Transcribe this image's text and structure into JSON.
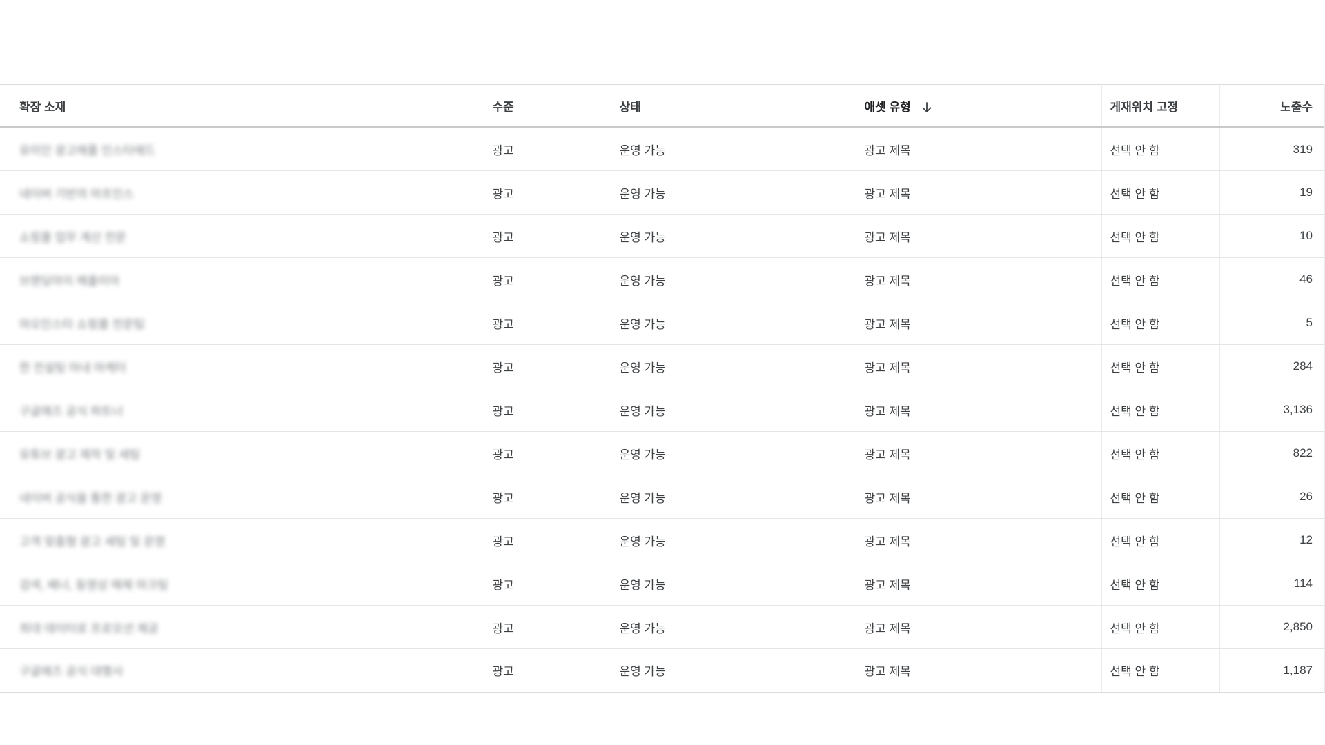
{
  "table": {
    "headers": {
      "asset": "확장 소재",
      "level": "수준",
      "status": "상태",
      "asset_type": "애셋 유형",
      "pinned": "게재위치 고정",
      "impressions": "노출수"
    },
    "sort": {
      "column": "asset_type",
      "direction": "descending",
      "icon": "arrow-down-icon"
    },
    "rows": [
      {
        "asset": "유미인 광고애플 인스타에드",
        "level": "광고",
        "status": "운영 가능",
        "asset_type": "광고 제목",
        "pinned": "선택 안 함",
        "impressions": "319"
      },
      {
        "asset": "네이버 기반의 마프인스",
        "level": "광고",
        "status": "운영 가능",
        "asset_type": "광고 제목",
        "pinned": "선택 안 함",
        "impressions": "19"
      },
      {
        "asset": "쇼핑몰 업무 계산 전문",
        "level": "광고",
        "status": "운영 가능",
        "asset_type": "광고 제목",
        "pinned": "선택 안 함",
        "impressions": "10"
      },
      {
        "asset": "브랜딩마이 매출미아",
        "level": "광고",
        "status": "운영 가능",
        "asset_type": "광고 제목",
        "pinned": "선택 안 함",
        "impressions": "46"
      },
      {
        "asset": "마오인스타 쇼핑몰 전문팀",
        "level": "광고",
        "status": "운영 가능",
        "asset_type": "광고 제목",
        "pinned": "선택 안 함",
        "impressions": "5"
      },
      {
        "asset": "한 컨설팅 마내 마케터",
        "level": "광고",
        "status": "운영 가능",
        "asset_type": "광고 제목",
        "pinned": "선택 안 함",
        "impressions": "284"
      },
      {
        "asset": "구글애즈 공식 파트너",
        "level": "광고",
        "status": "운영 가능",
        "asset_type": "광고 제목",
        "pinned": "선택 안 함",
        "impressions": "3,136"
      },
      {
        "asset": "유튜브 광고 제작 및 세팅",
        "level": "광고",
        "status": "운영 가능",
        "asset_type": "광고 제목",
        "pinned": "선택 안 함",
        "impressions": "822"
      },
      {
        "asset": "네이버 공식을 통한 광고 운영",
        "level": "광고",
        "status": "운영 가능",
        "asset_type": "광고 제목",
        "pinned": "선택 안 함",
        "impressions": "26"
      },
      {
        "asset": "고객 맞춤형 광고 세팅 및 운영",
        "level": "광고",
        "status": "운영 가능",
        "asset_type": "광고 제목",
        "pinned": "선택 안 함",
        "impressions": "12"
      },
      {
        "asset": "검색, 배너, 동영상 매체 마크팅",
        "level": "광고",
        "status": "운영 가능",
        "asset_type": "광고 제목",
        "pinned": "선택 안 함",
        "impressions": "114"
      },
      {
        "asset": "최대 데이터로 프로모션 제공",
        "level": "광고",
        "status": "운영 가능",
        "asset_type": "광고 제목",
        "pinned": "선택 안 함",
        "impressions": "2,850"
      },
      {
        "asset": "구글애즈 공식 대행사",
        "level": "광고",
        "status": "운영 가능",
        "asset_type": "광고 제목",
        "pinned": "선택 안 함",
        "impressions": "1,187"
      }
    ]
  }
}
